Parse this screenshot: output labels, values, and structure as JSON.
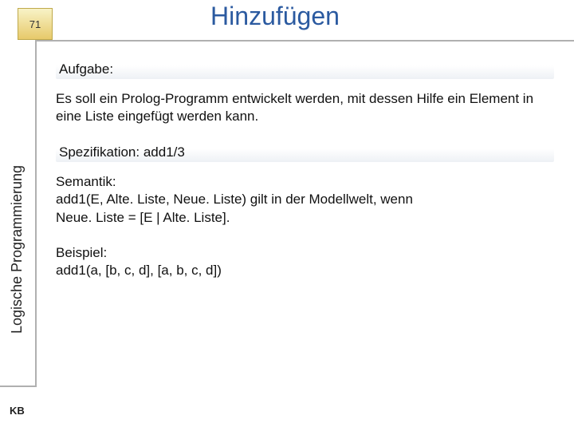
{
  "page_number": "71",
  "title": "Hinzufügen",
  "side_label": "Logische Programmierung",
  "sections": {
    "aufgabe_label": "Aufgabe:",
    "intro": "Es soll ein Prolog-Programm entwickelt werden, mit dessen Hilfe ein Element in eine Liste eingefügt werden kann.",
    "spezifikation": "Spezifikation: add1/3",
    "semantik_label": "Semantik:",
    "semantik_line1": "add1(E, Alte. Liste, Neue. Liste) gilt in der Modellwelt, wenn",
    "semantik_line2": "Neue. Liste = [E | Alte. Liste].",
    "beispiel_label": "Beispiel:",
    "beispiel_line": "add1(a, [b, c, d], [a, b, c, d])"
  },
  "footer_author": "KB"
}
